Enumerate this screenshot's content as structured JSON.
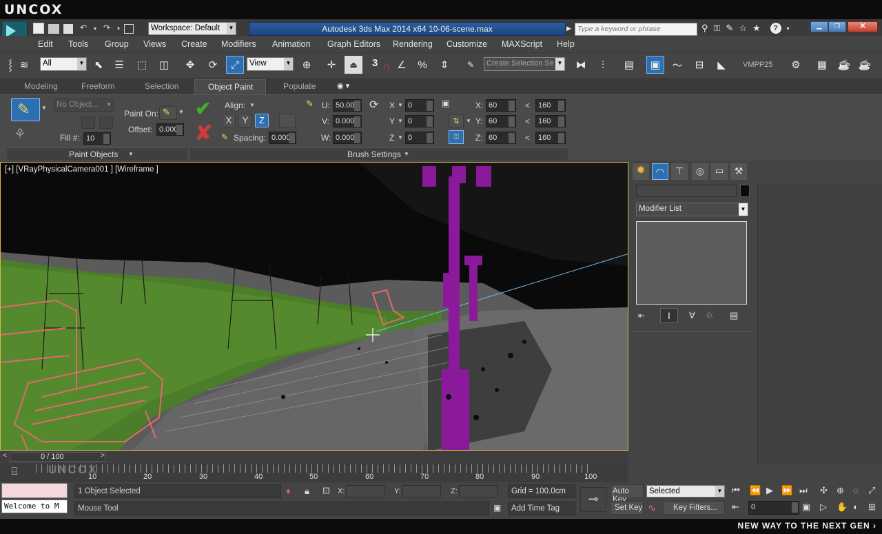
{
  "titlebar": {
    "logo_text": "UNCOX",
    "workspace": "Workspace: Default",
    "title": "Autodesk 3ds Max  2014 x64     10-06-scene.max",
    "search_placeholder": "Type a keyword or phrase",
    "help": "?"
  },
  "menu": [
    "Edit",
    "Tools",
    "Group",
    "Views",
    "Create",
    "Modifiers",
    "Animation",
    "Graph Editors",
    "Rendering",
    "Customize",
    "MAXScript",
    "Help"
  ],
  "toolbar": {
    "filter_value": "All",
    "refcoord_value": "View",
    "selection_set": "Create Selection Se",
    "snap3": "3",
    "vmpp": "VMPP25"
  },
  "ribbon": {
    "tabs": [
      "Modeling",
      "Freeform",
      "Selection",
      "Object Paint",
      "Populate"
    ],
    "active_tab": "Object Paint",
    "no_object": "No Object...",
    "paint_on_label": "Paint On:",
    "offset_label": "Offset:",
    "offset_value": "0.000",
    "fill_label": "Fill #:",
    "fill_value": "10",
    "align_label": "Align:",
    "axis_x": "X",
    "axis_y": "Y",
    "axis_z": "Z",
    "spacing_label": "Spacing:",
    "spacing_value": "0.000",
    "u_label": "U:",
    "u_value": "50.00",
    "v_label": "V:",
    "v_value": "0.000",
    "w_label": "W:",
    "w_value": "0.000",
    "rx_label": "X",
    "rx_value": "0",
    "ry_label": "Y",
    "ry_value": "0",
    "rz_label": "Z",
    "rz_value": "0",
    "sx_label": "X:",
    "sx_value": "60",
    "sx_max": "160",
    "sy_label": "Y:",
    "sy_value": "60",
    "sy_max": "160",
    "sz_label": "Z:",
    "sz_value": "60",
    "sz_max": "160",
    "lt": "<",
    "paint_objects": "Paint Objects",
    "brush_settings": "Brush Settings"
  },
  "viewport": {
    "label": "[+] [VRayPhysicalCamera001 ] [Wireframe ]"
  },
  "command_panel": {
    "modifier_list": "Modifier List"
  },
  "timeline": {
    "frame_counter": "0 / 100",
    "ticks": [
      "10",
      "20",
      "30",
      "40",
      "50",
      "60",
      "70",
      "80",
      "90",
      "100"
    ]
  },
  "status": {
    "maxscript_text": "Welcome to M",
    "selection_info": "1 Object Selected",
    "prompt": "Mouse Tool",
    "x_label": "X:",
    "y_label": "Y:",
    "z_label": "Z:",
    "grid": "Grid = 100.0cm",
    "add_time_tag": "Add Time Tag",
    "auto_key": "Auto Key",
    "set_key": "Set Key",
    "key_mode": "Selected",
    "key_filters": "Key Filters...",
    "current_frame": "0"
  },
  "watermark": {
    "bottom_text": "NEW WAY TO THE NEXT GEN ›",
    "overlay_logo": "UNCOX"
  },
  "colors": {
    "accent_blue": "#1f4f8c",
    "bench": "#e06a6a",
    "lamp": "#8a1a9a",
    "check_green": "#3fae2a",
    "cancel_red": "#d23b3b"
  }
}
